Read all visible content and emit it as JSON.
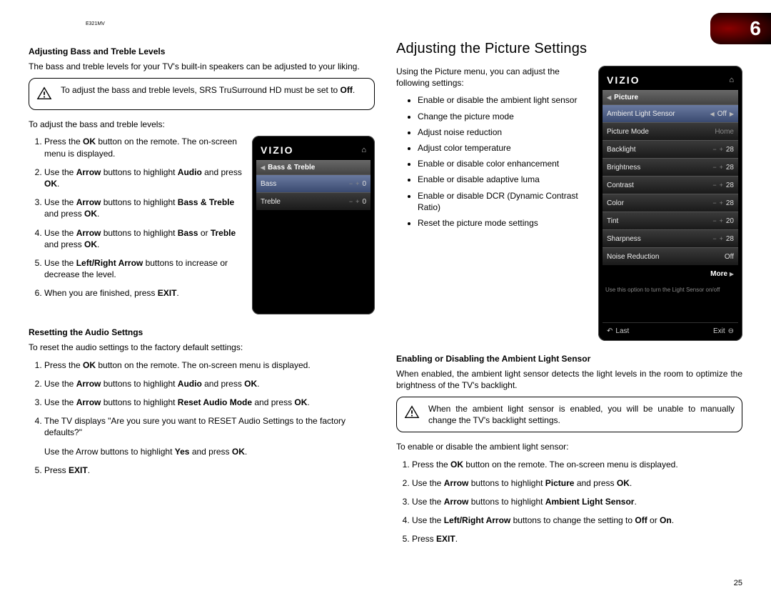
{
  "model": "E321MV",
  "chapter_number": "6",
  "page_number": "25",
  "left": {
    "heading1": "Adjusting Bass and Treble Levels",
    "intro1": "The bass and treble levels for your TV's built-in speakers can be adjusted to your liking.",
    "note1_pre": "To adjust the bass and treble levels, SRS TruSurround HD must be set to ",
    "note1_bold": "Off",
    "note1_post": ".",
    "lead1": "To adjust the bass and treble levels:",
    "steps1": {
      "s1a": "Press the ",
      "s1b": "OK",
      "s1c": " button on the remote. The on-screen menu is displayed.",
      "s2a": "Use the ",
      "s2b": "Arrow",
      "s2c": " buttons to highlight ",
      "s2d": "Audio",
      "s2e": " and press ",
      "s2f": "OK",
      "s2g": ".",
      "s3a": "Use the ",
      "s3b": "Arrow",
      "s3c": " buttons to highlight ",
      "s3d": "Bass & Treble",
      "s3e": " and press ",
      "s3f": "OK",
      "s3g": ".",
      "s4a": "Use the ",
      "s4b": "Arrow",
      "s4c": " buttons to highlight ",
      "s4d": "Bass",
      "s4e": " or ",
      "s4f": "Treble",
      "s4g": " and press ",
      "s4h": "OK",
      "s4i": ".",
      "s5a": "Use the ",
      "s5b": "Left/Right Arrow",
      "s5c": " buttons to increase or decrease the level.",
      "s6a": "When you are finished, press ",
      "s6b": "EXIT",
      "s6c": "."
    },
    "heading2": "Resetting the Audio Settngs",
    "intro2": "To reset the audio settings to the factory default settings:",
    "steps2": {
      "s1a": "Press the ",
      "s1b": "OK",
      "s1c": " button on the remote. The on-screen menu is displayed.",
      "s2a": "Use the ",
      "s2b": "Arrow",
      "s2c": " buttons to highlight ",
      "s2d": "Audio",
      "s2e": " and press ",
      "s2f": "OK",
      "s2g": ".",
      "s3a": "Use the ",
      "s3b": "Arrow",
      "s3c": " buttons to highlight ",
      "s3d": "Reset Audio Mode",
      "s3e": " and press ",
      "s3f": "OK",
      "s3g": ".",
      "s4a": "The TV displays \"Are you sure you want to RESET Audio Settings to the factory defaults?\"",
      "s4b_a": "Use the Arrow buttons to highlight ",
      "s4b_b": "Yes",
      "s4b_c": " and press ",
      "s4b_d": "OK",
      "s4b_e": ".",
      "s5a": "Press ",
      "s5b": "EXIT",
      "s5c": "."
    },
    "osd_small": {
      "brand": "VIZIO",
      "title": "Bass & Treble",
      "bass_label": "Bass",
      "bass_val": "0",
      "treble_label": "Treble",
      "treble_val": "0"
    }
  },
  "right": {
    "section_title": "Adjusting the Picture Settings",
    "intro": "Using the Picture menu, you can adjust the following settings:",
    "bullets": [
      "Enable or disable the ambient light sensor",
      "Change the picture mode",
      "Adjust noise reduction",
      "Adjust color temperature",
      "Enable or disable color enhancement",
      "Enable or disable adaptive luma",
      "Enable or disable DCR (Dynamic Contrast Ratio)",
      "Reset the picture mode settings"
    ],
    "heading2": "Enabling or Disabling the Ambient Light Sensor",
    "intro2": "When enabled, the ambient light sensor detects the light levels in the room to optimize the brightness of the TV's backlight.",
    "note2": "When the ambient light sensor is enabled, you will be unable to manually change the TV's backlight settings.",
    "lead2": "To enable or disable the ambient light sensor:",
    "steps": {
      "s1a": "Press the ",
      "s1b": "OK",
      "s1c": " button on the remote. The on-screen menu is displayed.",
      "s2a": "Use the ",
      "s2b": "Arrow",
      "s2c": " buttons to highlight ",
      "s2d": "Picture",
      "s2e": " and press ",
      "s2f": "OK",
      "s2g": ".",
      "s3a": "Use the ",
      "s3b": "Arrow",
      "s3c": " buttons to highlight ",
      "s3d": "Ambient Light Sensor",
      "s3e": ".",
      "s4a": "Use the ",
      "s4b": "Left/Right Arrow",
      "s4c": " buttons to change the setting to ",
      "s4d": "Off",
      "s4e": " or ",
      "s4f": "On",
      "s4g": ".",
      "s5a": "Press ",
      "s5b": "EXIT",
      "s5c": "."
    },
    "osd_big": {
      "brand": "VIZIO",
      "title": "Picture",
      "rows": {
        "als_label": "Ambient Light Sensor",
        "als_val": "Off",
        "pm_label": "Picture Mode",
        "pm_val": "Home",
        "bl_label": "Backlight",
        "bl_val": "28",
        "br_label": "Brightness",
        "br_val": "28",
        "ct_label": "Contrast",
        "ct_val": "28",
        "co_label": "Color",
        "co_val": "28",
        "ti_label": "Tint",
        "ti_val": "20",
        "sh_label": "Sharpness",
        "sh_val": "28",
        "nr_label": "Noise Reduction",
        "nr_val": "Off"
      },
      "more": "More",
      "hint": "Use this option to turn the Light Sensor on/off",
      "footer_left": "Last",
      "footer_right": "Exit"
    }
  }
}
